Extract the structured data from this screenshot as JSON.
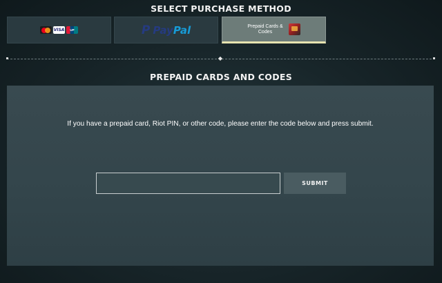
{
  "page": {
    "select_heading": "SELECT PURCHASE METHOD",
    "section_heading": "PREPAID CARDS AND CODES"
  },
  "methods": {
    "cards": {
      "items": [
        {
          "icon": "mastercard-icon",
          "label": ""
        },
        {
          "icon": "visa-icon",
          "label": "VISA"
        },
        {
          "icon": "unionpay-icon",
          "label": "UP"
        }
      ]
    },
    "paypal": {
      "mark": "P",
      "label_a": "Pay",
      "label_b": "Pal"
    },
    "prepaid": {
      "label": "Prepaid Cards & Codes",
      "icon": "prepaid-card-icon",
      "selected": true
    }
  },
  "form": {
    "instructions": "If you have a prepaid card, Riot PIN, or other code, please enter the code below and press submit.",
    "code_value": "",
    "code_placeholder": "",
    "submit_label": "SUBMIT"
  },
  "colors": {
    "background": "#172428",
    "panel": "#394a50",
    "selected_tab": "#6d7c79",
    "selected_underline": "#e7e3b0",
    "paypal_dark": "#253b80",
    "paypal_light": "#179bd7"
  }
}
